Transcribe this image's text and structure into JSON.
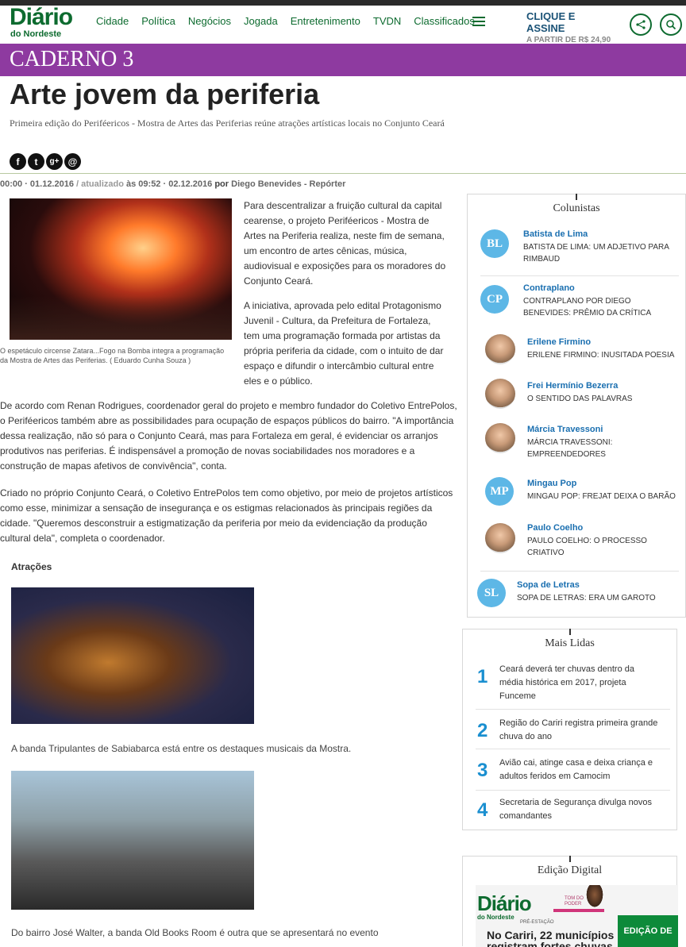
{
  "header": {
    "logo_main": "Diário",
    "logo_sub": "do Nordeste",
    "nav": [
      "Cidade",
      "Política",
      "Negócios",
      "Jogada",
      "Entretenimento",
      "TVDN",
      "Classificados"
    ],
    "subscribe_line1": "CLIQUE E ASSINE",
    "subscribe_line2": "A PARTIR DE R$ 24,90",
    "share_icon": "share-icon",
    "search_icon": "search-icon",
    "menu_icon": "hamburger-icon"
  },
  "section": "CADERNO 3",
  "article": {
    "title": "Arte jovem da periferia",
    "subtitle": "Primeira edição do Periféericos - Mostra de Artes das Periferias reúne atrações artísticas locais no Conjunto Ceará",
    "share_icons": {
      "facebook": "f",
      "twitter": "t",
      "gplus": "g+",
      "email": "@"
    },
    "meta": {
      "published": "00:00 · 01.12.2016",
      "separator": " / ",
      "updated_label": "atualizado",
      "updated_at": "às 09:52 · 02.12.2016",
      "by": "por",
      "author": "Diego Benevides - Repórter"
    },
    "photo1_caption": "O espetáculo circense Zatara...Fogo na Bomba integra a programação da Mostra de Artes das Periferias. ( Eduardo Cunha Souza )",
    "paragraphs": [
      "Para descentralizar a fruição cultural da capital cearense, o projeto Periféericos - Mostra de Artes na Periferia realiza, neste fim de semana, um encontro de artes cênicas, música, audiovisual e exposições para os moradores do Conjunto Ceará.",
      "A iniciativa, aprovada pelo edital Protagonismo Juvenil - Cultura, da Prefeitura de Fortaleza, tem uma programação formada por artistas da própria periferia da cidade, com o intuito de dar espaço e difundir o intercâmbio cultural entre eles e o público.",
      "De acordo com Renan Rodrigues, coordenador geral do projeto e membro fundador do Coletivo EntrePolos, o Periféericos também abre as possibilidades para ocupação de espaços públicos do bairro. \"A importância dessa realização, não só para o Conjunto Ceará, mas para Fortaleza em geral, é evidenciar os arranjos produtivos nas periferias. É indispensável a promoção de novas sociabilidades nos moradores e a construção de mapas afetivos de convivência\", conta.",
      "Criado no próprio Conjunto Ceará, o Coletivo EntrePolos tem como objetivo, por meio de projetos artísticos como esse, minimizar a sensação de insegurança e os estigmas relacionados às principais regiões da cidade. \"Queremos desconstruir a estigmatização da periferia por meio da evidenciação da produção cultural dela\", completa o coordenador."
    ],
    "attractions_heading": "Atrações",
    "photo2_caption": "A banda Tripulantes de Sabiabarca está entre os destaques musicais da Mostra.",
    "photo3_caption": "Do bairro José Walter, a banda Old Books Room é outra que se apresentará no evento"
  },
  "columnists": {
    "title": "Colunistas",
    "items": [
      {
        "initials": "BL",
        "name": "Batista de Lima",
        "desc": "BATISTA DE LIMA: UM ADJETIVO PARA RIMBAUD"
      },
      {
        "initials": "CP",
        "name": "Contraplano",
        "desc": "CONTRAPLANO POR DIEGO BENEVIDES: PRÊMIO DA CRÍTICA"
      },
      {
        "initials": "",
        "name": "Erilene Firmino",
        "desc": "ERILENE FIRMINO: INUSITADA POESIA"
      },
      {
        "initials": "",
        "name": "Frei Hermínio Bezerra",
        "desc": "O SENTIDO DAS PALAVRAS"
      },
      {
        "initials": "",
        "name": "Márcia Travessoni",
        "desc": "MÁRCIA TRAVESSONI: EMPREENDEDORES"
      },
      {
        "initials": "MP",
        "name": "Mingau Pop",
        "desc": "MINGAU POP: FREJAT DEIXA O BARÃO"
      },
      {
        "initials": "",
        "name": "Paulo Coelho",
        "desc": "PAULO COELHO: O PROCESSO CRIATIVO"
      },
      {
        "initials": "SL",
        "name": "Sopa de Letras",
        "desc": "SOPA DE LETRAS: ERA UM GAROTO"
      }
    ]
  },
  "mais_lidas": {
    "title": "Mais Lidas",
    "items": [
      {
        "n": "1",
        "text": "Ceará deverá ter chuvas dentro da média histórica em 2017, projeta Funceme"
      },
      {
        "n": "2",
        "text": "Região do Cariri registra primeira grande chuva do ano"
      },
      {
        "n": "3",
        "text": "Avião cai, atinge casa e deixa criança e adultos feridos em Camocim"
      },
      {
        "n": "4",
        "text": "Secretaria de Segurança divulga novos comandantes"
      }
    ]
  },
  "edicao_digital": {
    "title": "Edição Digital",
    "logo": "Diário",
    "logo_sub": "do Nordeste",
    "pre_label": "PRÉ-ESTAÇÃO",
    "headline_l1": "No Cariri, 22 municípios",
    "headline_l2": "registram fortes chuvas",
    "top_label": "TOM DO PODER",
    "button": "EDIÇÃO DE"
  },
  "colors": {
    "brand_green": "#0d6b2f",
    "section_purple": "#8e3aa0",
    "link_blue": "#1a6fb0",
    "accent_blue": "#5db7e6"
  }
}
